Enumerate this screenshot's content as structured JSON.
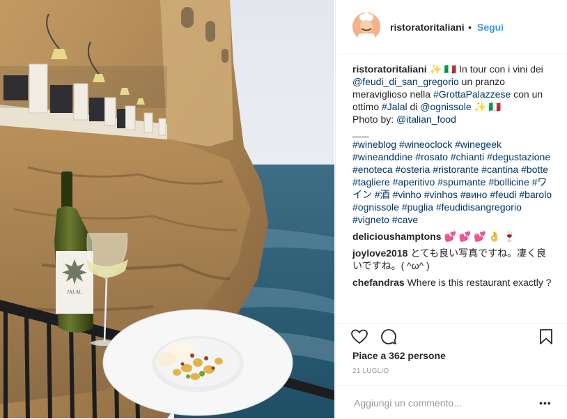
{
  "post_header": {
    "username": "ristoratoritaliani",
    "separator": "•",
    "follow_label": "Segui"
  },
  "caption": {
    "username": "ristoratoritaliani",
    "emoji_a": "✨ 🇮🇹",
    "text_a": "In tour con i vini dei",
    "mention_feudi": "@feudi_di_san_gregorio",
    "text_b": "un pranzo meraviglioso nella",
    "tag_grotta": "#GrottaPalazzese",
    "text_c": "con un ottimo",
    "tag_jalal": "#Jalal",
    "text_d": "di",
    "mention_ognissole": "@ognissole",
    "emoji_b": "✨ 🇮🇹",
    "photo_by": "Photo by:",
    "mention_food": "@italian_food",
    "divider": "___",
    "hashtags": [
      "#wineblog",
      "#wineoclock",
      "#winegeek",
      "#wineanddine",
      "#rosato",
      "#chianti",
      "#degustazione",
      "#enoteca",
      "#osteria",
      "#ristorante",
      "#cantina",
      "#botte",
      "#tagliere",
      "#aperitivo",
      "#spumante",
      "#bollicine",
      "#ワイン",
      "#酒",
      "#vinho",
      "#vinhos",
      "#вино",
      "#feudi",
      "#barolo",
      "#ognissole",
      "#puglia",
      "#feudidisangregorio",
      "#vigneto",
      "#cave"
    ]
  },
  "comments": [
    {
      "user": "delicioushamptons",
      "text": "💕 💕 💕 👌 🍷"
    },
    {
      "user": "joylove2018",
      "text": "とても良い写真ですね。凄く良いですね。( ^ω^ )"
    },
    {
      "user": "chefandras",
      "text": "Where is this restaurant exactly ?"
    }
  ],
  "actions": {
    "likes_text": "Piace a 362 persone",
    "date": "21 LUGLIO",
    "icons": [
      "heart-icon",
      "comment-icon",
      "bookmark-icon"
    ]
  },
  "add_comment": {
    "placeholder": "Aggiungi un commento...",
    "more": "•••"
  },
  "photo": {
    "label_on_bottle": "JALAL"
  }
}
